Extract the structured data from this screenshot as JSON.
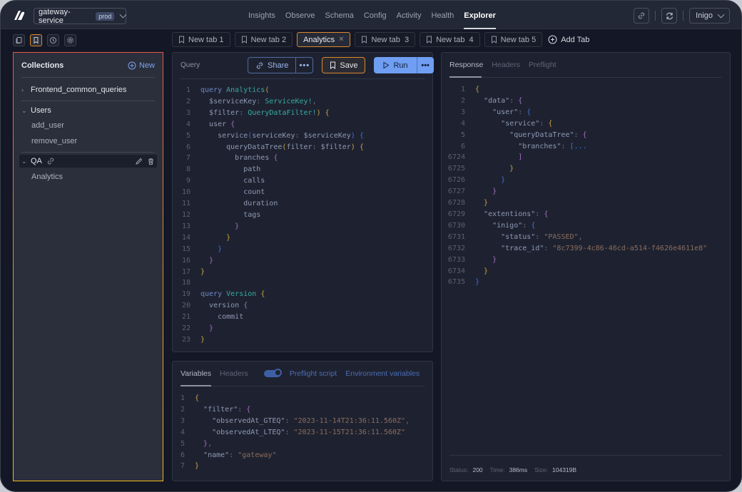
{
  "topbar": {
    "service_name": "gateway-service",
    "env_badge": "prod",
    "nav": [
      {
        "label": "Insights",
        "active": false
      },
      {
        "label": "Observe",
        "active": false
      },
      {
        "label": "Schema",
        "active": false
      },
      {
        "label": "Config",
        "active": false
      },
      {
        "label": "Activity",
        "active": false
      },
      {
        "label": "Health",
        "active": false
      },
      {
        "label": "Explorer",
        "active": true
      }
    ],
    "user": "Inigo"
  },
  "sidebar_tools": [
    "copy-icon",
    "bookmark-icon",
    "history-icon",
    "settings-icon"
  ],
  "tabs": [
    {
      "label": "New tab 1",
      "active": false
    },
    {
      "label": "New tab 2",
      "active": false
    },
    {
      "label": "Analytics",
      "active": true
    },
    {
      "label": "New tab  3",
      "active": false
    },
    {
      "label": "New tab  4",
      "active": false
    },
    {
      "label": "New tab 5",
      "active": false
    }
  ],
  "add_tab_label": "Add Tab",
  "collections": {
    "title": "Collections",
    "new_label": "New",
    "groups": [
      {
        "name": "Frontend_common_queries",
        "expanded": false,
        "items": []
      },
      {
        "name": "Users",
        "expanded": true,
        "items": [
          "add_user",
          "remove_user"
        ]
      },
      {
        "name": "QA",
        "expanded": true,
        "selected": true,
        "items": [
          "Analytics"
        ]
      }
    ]
  },
  "query": {
    "label": "Query",
    "share_label": "Share",
    "save_label": "Save",
    "run_label": "Run",
    "lines": [
      "query Analytics(",
      "  $serviceKey: ServiceKey!,",
      "  $filter: QueryDataFilter!) {",
      "  user {",
      "    service(serviceKey: $serviceKey) {",
      "      queryDataTree(filter: $filter) {",
      "        branches {",
      "          path",
      "          calls",
      "          count",
      "          duration",
      "          tags",
      "        }",
      "      }",
      "    }",
      "  }",
      "}",
      "",
      "query Version {",
      "  version {",
      "    commit",
      "  }",
      "}"
    ]
  },
  "variables": {
    "tabs": [
      "Variables",
      "Headers"
    ],
    "active_tab": "Variables",
    "preflight_label": "Preflight script",
    "preflight_enabled": true,
    "env_label": "Environment variables",
    "lines": [
      "{",
      "  \"filter\": {",
      "    \"observedAt_GTEQ\": \"2023-11-14T21:36:11.560Z\",",
      "    \"observedAt_LTEQ\": \"2023-11-15T21:36:11.560Z\"",
      "  },",
      "  \"name\": \"gateway\"",
      "}"
    ]
  },
  "response": {
    "tabs": [
      "Response",
      "Headers",
      "Preflight"
    ],
    "active_tab": "Response",
    "lines": [
      {
        "n": "1",
        "text": "{"
      },
      {
        "n": "2",
        "text": "  \"data\": {"
      },
      {
        "n": "3",
        "text": "    \"user\": {"
      },
      {
        "n": "4",
        "text": "      \"service\": {"
      },
      {
        "n": "5",
        "text": "        \"queryDataTree\": {"
      },
      {
        "n": "6",
        "text": "          \"branches\": [..."
      },
      {
        "n": "6724",
        "text": "          ]"
      },
      {
        "n": "6725",
        "text": "        }"
      },
      {
        "n": "6726",
        "text": "      }"
      },
      {
        "n": "6727",
        "text": "    }"
      },
      {
        "n": "6728",
        "text": "  }"
      },
      {
        "n": "6729",
        "text": "  \"extentions\": {"
      },
      {
        "n": "6730",
        "text": "    \"inigo\": {"
      },
      {
        "n": "6731",
        "text": "      \"status\": \"PASSED\","
      },
      {
        "n": "6732",
        "text": "      \"trace_id\": \"8c7399-4c86-46cd-a514-f4626e4611e8\""
      },
      {
        "n": "6733",
        "text": "    }"
      },
      {
        "n": "6734",
        "text": "  }"
      },
      {
        "n": "6735",
        "text": "}"
      }
    ],
    "status_label": "Status:",
    "status": "200",
    "time_label": "Time:",
    "time": "386ms",
    "size_label": "Size:",
    "size": "104319B"
  }
}
